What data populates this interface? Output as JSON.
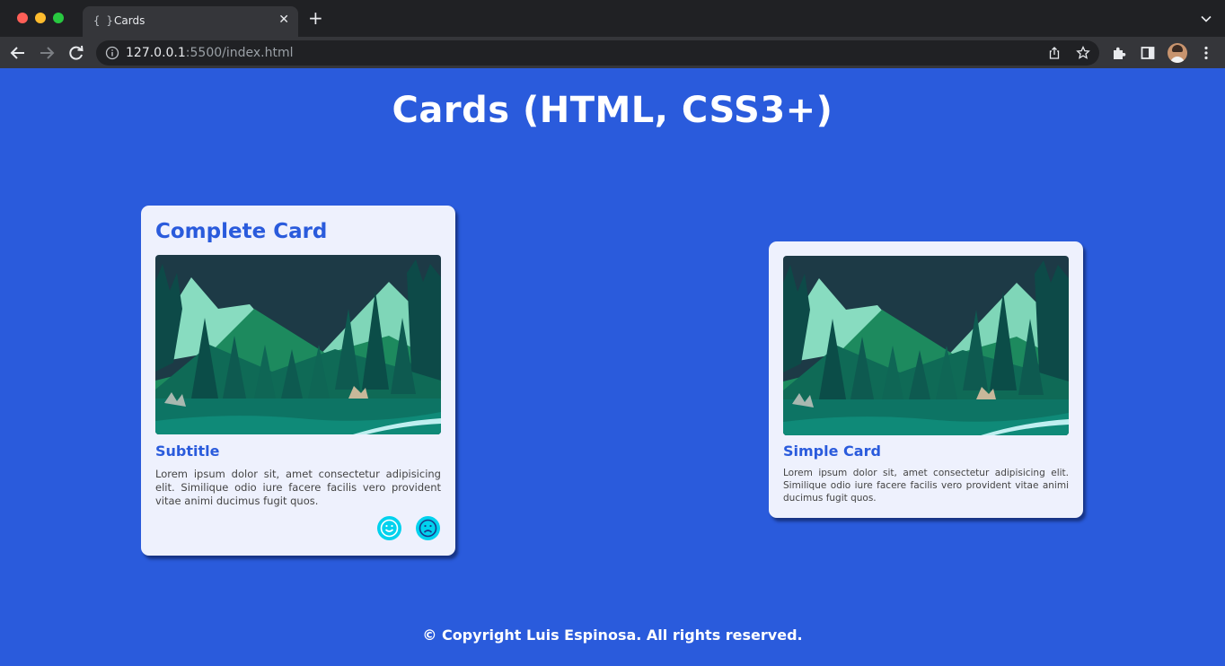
{
  "browser": {
    "tab_favicon": "{ }",
    "tab_title": "Cards",
    "tab_close": "✕",
    "new_tab": "+",
    "url_host": "127.0.0.1",
    "url_rest": ":5500/index.html"
  },
  "page": {
    "title": "Cards (HTML, CSS3+)"
  },
  "cards": {
    "complete": {
      "title": "Complete Card",
      "subtitle": "Subtitle",
      "text": "Lorem ipsum dolor sit, amet consectetur adipisicing elit. Similique odio iure facere facilis vero provident vitae animi ducimus fugit quos.",
      "icons": [
        "smile-icon",
        "frown-icon"
      ],
      "image": "forest-mountain-landscape"
    },
    "simple": {
      "subtitle": "Simple Card",
      "text": "Lorem ipsum dolor sit, amet consectetur adipisicing elit. Similique odio iure facere facilis vero provident vitae animi ducimus fugit quos.",
      "image": "forest-mountain-landscape"
    }
  },
  "footer": {
    "text": "© Copyright Luis Espinosa. All rights reserved."
  },
  "colors": {
    "background": "#2a5bdc",
    "card_bg": "#eef1fd",
    "accent": "#2a5bdc",
    "emoji_button": "#00d2ee"
  }
}
